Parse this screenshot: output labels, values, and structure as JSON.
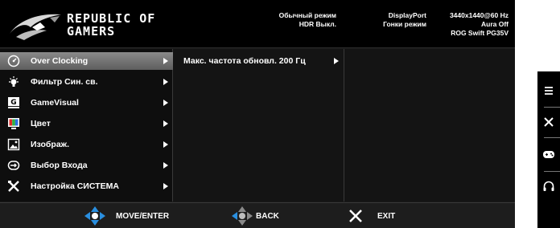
{
  "brand": {
    "line1": "REPUBLIC OF",
    "line2": "GAMERS",
    "icon": "rog-eye-logo"
  },
  "status": {
    "mode": "Обычный режим",
    "hdr": "HDR Выкл.",
    "input": "DisplayPort",
    "racing": "Гонки режим",
    "resolution": "3440x1440@60 Hz",
    "aura": "Aura Off",
    "model": "ROG Swift PG35V"
  },
  "menu": {
    "selected_index": 0,
    "items": [
      {
        "label": "Over Clocking",
        "icon": "speedometer-icon"
      },
      {
        "label": "Фильтр Син. св.",
        "icon": "bulb-icon"
      },
      {
        "label": "GameVisual",
        "icon": "gamevisual-icon"
      },
      {
        "label": "Цвет",
        "icon": "color-icon"
      },
      {
        "label": "Изображ.",
        "icon": "image-icon"
      },
      {
        "label": "Выбор Входа",
        "icon": "input-icon"
      },
      {
        "label": "Настройка СИСТЕМА",
        "icon": "tools-icon"
      }
    ]
  },
  "submenu": {
    "items": [
      {
        "label": "Макс. частота обновл. 200 Гц"
      }
    ]
  },
  "footer": {
    "move": "MOVE/ENTER",
    "back": "BACK",
    "exit": "EXIT"
  },
  "sidebar": {
    "icons": [
      "menu-icon",
      "close-icon",
      "gamepad-icon",
      "headphones-icon"
    ]
  },
  "colors": {
    "accent_blue": "#2a8fe0",
    "selected_bg": "#7a7a7a",
    "background": "#1a1a1a"
  }
}
